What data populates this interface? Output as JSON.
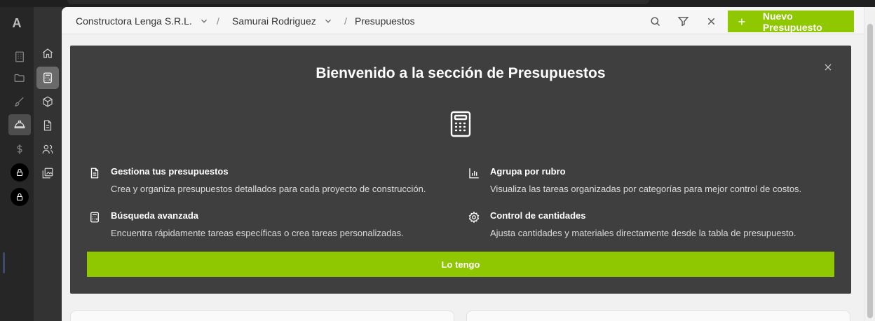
{
  "app": {
    "logo_letter": "A"
  },
  "breadcrumb": {
    "company": "Constructora Lenga S.R.L.",
    "project": "Samurai Rodriguez",
    "section": "Presupuestos",
    "separator": "/"
  },
  "toolbar": {
    "new_button_label": "Nuevo Presupuesto"
  },
  "modal": {
    "title": "Bienvenido a la sección de Presupuestos",
    "features": [
      {
        "title": "Gestiona tus presupuestos",
        "description": "Crea y organiza presupuestos detallados para cada proyecto de construcción.",
        "icon": "document-icon"
      },
      {
        "title": "Agrupa por rubro",
        "description": "Visualiza las tareas organizadas por categorías para mejor control de costos.",
        "icon": "bar-chart-icon"
      },
      {
        "title": "Búsqueda avanzada",
        "description": "Encuentra rápidamente tareas específicas o crea tareas personalizadas.",
        "icon": "calculator-icon"
      },
      {
        "title": "Control de cantidades",
        "description": "Ajusta cantidades y materiales directamente desde la tabla de presupuesto.",
        "icon": "gear-icon"
      }
    ],
    "confirm_label": "Lo tengo"
  },
  "colors": {
    "accent": "#8fc800",
    "modal_bg": "#3f3f3f",
    "rail_bg": "#262626"
  }
}
